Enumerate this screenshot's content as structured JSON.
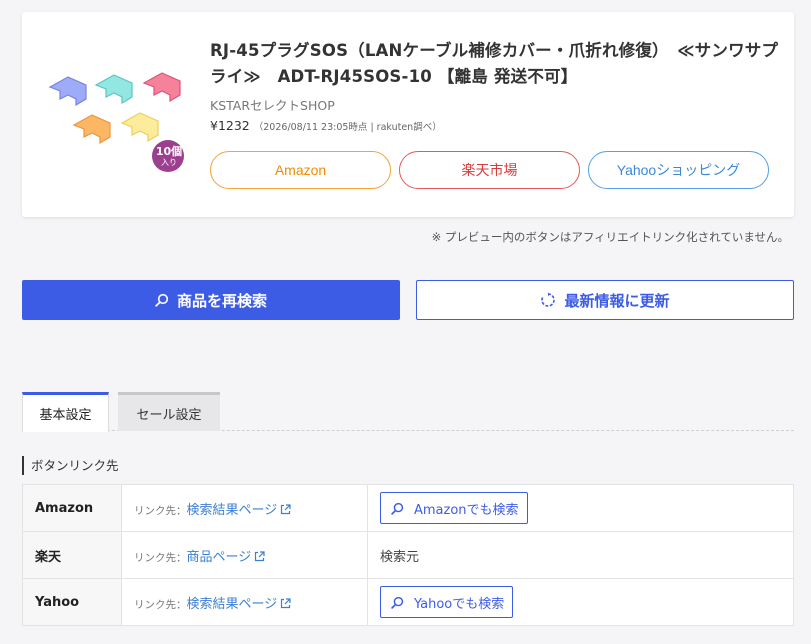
{
  "preview": {
    "title": "RJ-45プラグSOS（LANケーブル補修カバー・爪折れ修復）　≪サンワサプライ≫　ADT-RJ45SOS-10 【離島 発送不可】",
    "shop": "KSTARセレクトSHOP",
    "price": "¥1232",
    "price_note": "（2026/08/11 23:05時点 | rakuten調べ）",
    "badge_count": "10個",
    "badge_unit": "入り",
    "buttons": {
      "amazon": "Amazon",
      "rakuten": "楽天市場",
      "yahoo": "Yahooショッピング"
    }
  },
  "disclaimer": "※ プレビュー内のボタンはアフィリエイトリンク化されていません。",
  "actions": {
    "research": "商品を再検索",
    "refresh": "最新情報に更新"
  },
  "tabs": {
    "basic": "基本設定",
    "sale": "セール設定"
  },
  "section_title": "ボタンリンク先",
  "link_rows": [
    {
      "store": "Amazon",
      "prefix": "リンク先：",
      "target": "検索結果ページ",
      "action_label": "Amazonでも検索"
    },
    {
      "store": "楽天",
      "prefix": "リンク先：",
      "target": "商品ページ",
      "action_text": "検索元"
    },
    {
      "store": "Yahoo",
      "prefix": "リンク先：",
      "target": "検索結果ページ",
      "action_label": "Yahooでも検索"
    }
  ],
  "colors": {
    "primary": "#3d5ce6",
    "amazon": "#f08c00",
    "rakuten": "#d83a3a",
    "yahoo": "#3b88d8",
    "badge": "#9b3f8e"
  },
  "icons": {
    "search": "search-icon",
    "refresh": "refresh-icon",
    "external": "external-link-icon"
  }
}
